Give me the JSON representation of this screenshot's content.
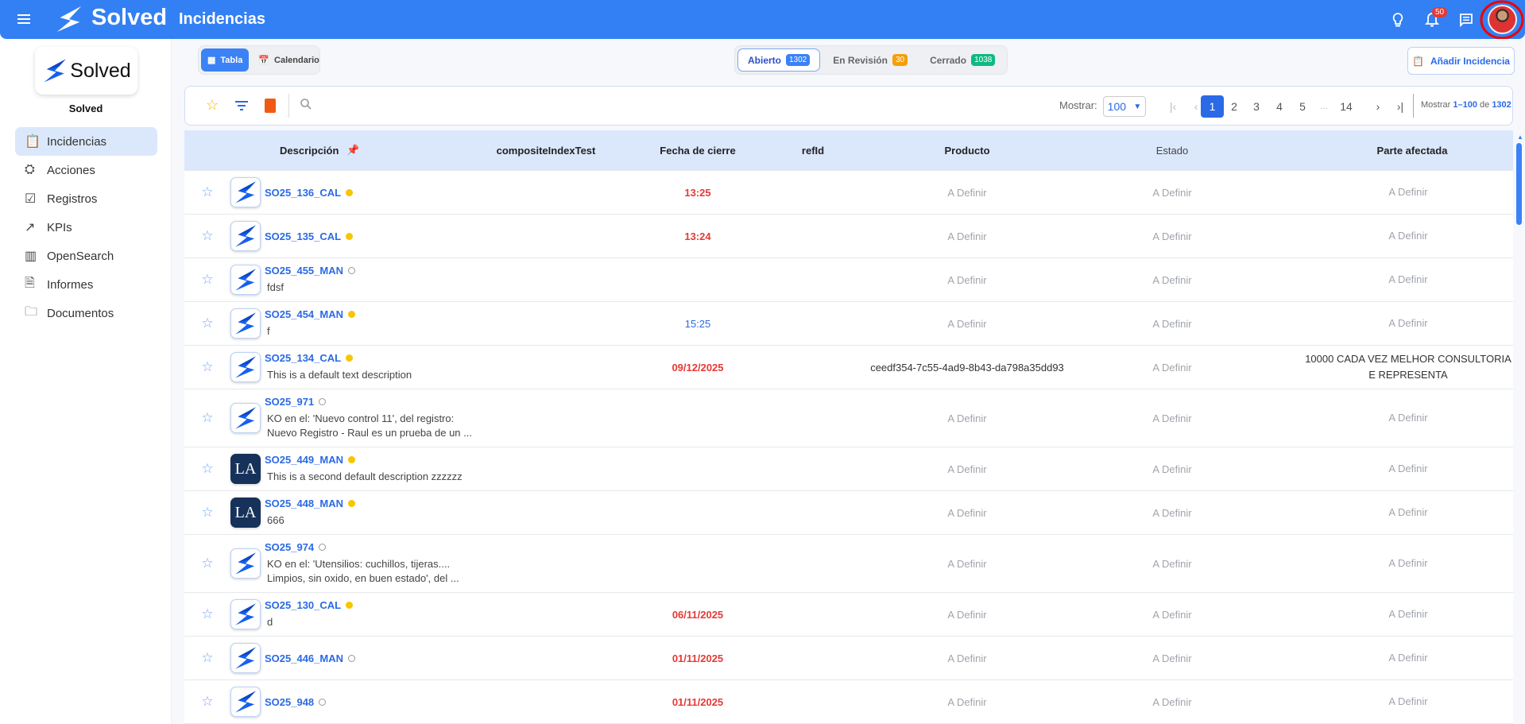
{
  "header": {
    "brand": "Solved",
    "title": "Incidencias",
    "notifications": "50"
  },
  "sidebar": {
    "org_name": "Solved",
    "logo_text": "Solved",
    "items": [
      {
        "label": "Incidencias",
        "icon": "clipboard-icon",
        "active": true
      },
      {
        "label": "Acciones",
        "icon": "user-check-icon"
      },
      {
        "label": "Registros",
        "icon": "checklist-icon"
      },
      {
        "label": "KPIs",
        "icon": "trend-icon"
      },
      {
        "label": "OpenSearch",
        "icon": "bar-chart-icon"
      },
      {
        "label": "Informes",
        "icon": "document-icon"
      },
      {
        "label": "Documentos",
        "icon": "folder-icon"
      }
    ]
  },
  "views": {
    "table": "Tabla",
    "calendar": "Calendario"
  },
  "status_tabs": [
    {
      "label": "Abierto",
      "count": "1302",
      "color": "#3a82f6",
      "active": true
    },
    {
      "label": "En Revisión",
      "count": "30",
      "color": "#f59e0b"
    },
    {
      "label": "Cerrado",
      "count": "1038",
      "color": "#10b981"
    }
  ],
  "add_button": "Añadir Incidencia",
  "pagination": {
    "show_label": "Mostrar:",
    "page_size": "100",
    "pages": [
      "1",
      "2",
      "3",
      "4",
      "5",
      "...",
      "14"
    ],
    "current": "1",
    "summary_prefix": "Mostrar",
    "range": "1–100",
    "of": "de",
    "total": "1302"
  },
  "columns": {
    "description": "Descripción",
    "composite": "compositeIndexTest",
    "close_date": "Fecha de cierre",
    "refid": "refId",
    "product": "Producto",
    "status": "Estado",
    "affected": "Parte afectada"
  },
  "rows": [
    {
      "id": "SO25_136_CAL",
      "dot": "filled",
      "desc": "",
      "logo": "solved",
      "date": "13:25",
      "date_color": "red",
      "product": "A Definir",
      "status": "A Definir",
      "affected": "A Definir"
    },
    {
      "id": "SO25_135_CAL",
      "dot": "filled",
      "desc": "",
      "logo": "solved",
      "date": "13:24",
      "date_color": "red",
      "product": "A Definir",
      "status": "A Definir",
      "affected": "A Definir"
    },
    {
      "id": "SO25_455_MAN",
      "dot": "empty",
      "desc": "fdsf",
      "logo": "solved",
      "date": "",
      "product": "A Definir",
      "status": "A Definir",
      "affected": "A Definir"
    },
    {
      "id": "SO25_454_MAN",
      "dot": "filled",
      "desc": "f",
      "logo": "solved",
      "date": "15:25",
      "date_color": "blue",
      "product": "A Definir",
      "status": "A Definir",
      "affected": "A Definir"
    },
    {
      "id": "SO25_134_CAL",
      "dot": "filled",
      "desc": "This is a default text description",
      "logo": "solved",
      "date": "09/12/2025",
      "date_color": "red",
      "product": "ceedf354-7c55-4ad9-8b43-da798a35dd93",
      "product_plain": true,
      "status": "A Definir",
      "affected": "10000 CADA VEZ MELHOR CONSULTORIA E REPRESENTA",
      "affected_plain": true
    },
    {
      "id": "SO25_971",
      "dot": "empty",
      "desc": "KO en el: 'Nuevo control 11', del registro: Nuevo Registro - Raul  es un prueba de un ...",
      "logo": "solved",
      "date": "",
      "product": "A Definir",
      "status": "A Definir",
      "affected": "A Definir",
      "tall": true
    },
    {
      "id": "SO25_449_MAN",
      "dot": "filled",
      "desc": "This is a second default description zzzzzz",
      "logo": "la",
      "logo_text": "LA",
      "date": "",
      "product": "A Definir",
      "status": "A Definir",
      "affected": "A Definir"
    },
    {
      "id": "SO25_448_MAN",
      "dot": "filled",
      "desc": "666",
      "logo": "la",
      "logo_text": "LA",
      "date": "",
      "product": "A Definir",
      "status": "A Definir",
      "affected": "A Definir"
    },
    {
      "id": "SO25_974",
      "dot": "empty",
      "desc": "KO en el: 'Utensilios: cuchillos, tijeras.... Limpios, sin oxido, en buen estado', del ...",
      "logo": "solved",
      "date": "",
      "product": "A Definir",
      "status": "A Definir",
      "affected": "A Definir",
      "tall": true
    },
    {
      "id": "SO25_130_CAL",
      "dot": "filled",
      "desc": "d",
      "logo": "solved",
      "date": "06/11/2025",
      "date_color": "red",
      "product": "A Definir",
      "status": "A Definir",
      "affected": "A Definir"
    },
    {
      "id": "SO25_446_MAN",
      "dot": "empty",
      "desc": "",
      "logo": "solved",
      "date": "01/11/2025",
      "date_color": "red",
      "product": "A Definir",
      "status": "A Definir",
      "affected": "A Definir"
    },
    {
      "id": "SO25_948",
      "dot": "empty",
      "desc": "",
      "logo": "solved",
      "date": "01/11/2025",
      "date_color": "red",
      "product": "A Definir",
      "status": "A Definir",
      "affected": "A Definir"
    }
  ]
}
